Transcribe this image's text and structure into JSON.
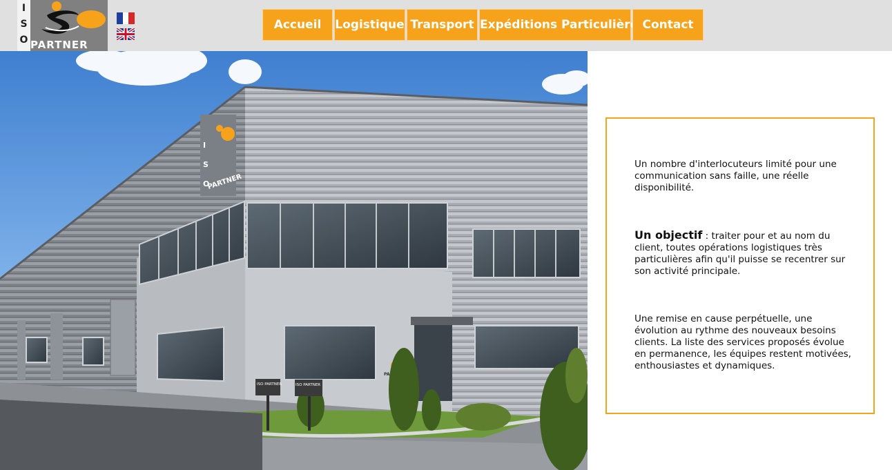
{
  "logo": {
    "letters": [
      "I",
      "S",
      "O"
    ],
    "partner_text": "PARTNER"
  },
  "languages": [
    {
      "code": "fr",
      "icon": "flag-france-icon"
    },
    {
      "code": "en",
      "icon": "flag-uk-icon"
    }
  ],
  "nav": {
    "items": [
      {
        "label": "Accueil"
      },
      {
        "label": "Logistique"
      },
      {
        "label": "Transport"
      },
      {
        "label": "Expéditions Particulières"
      },
      {
        "label": "Contact"
      }
    ]
  },
  "photo": {
    "sign_1": "ISO PARTNER",
    "sign_2": "ISO PARTNER",
    "wall_logo_letters": [
      "I",
      "S",
      "O"
    ],
    "wall_logo_partner": "PARTNER",
    "entrance_logo": "PARTNER"
  },
  "content": {
    "paragraph_1": "Un nombre d'interlocuteurs limité pour une communication sans faille, une réelle disponibilité.",
    "paragraph_2_lead": "Un objectif",
    "paragraph_2_rest": " : traiter pour et au nom du client, toutes opérations logistiques très particulières afin qu'il puisse se recentrer sur son activité principale.",
    "paragraph_3": "Une remise en cause perpétuelle, une évolution au rythme des nouveaux besoins clients. La liste des services proposés évolue en permanence, les équipes restent motivées, enthousiastes et dynamiques."
  },
  "colors": {
    "accent": "#f7a21b",
    "header_bg": "#e0e0e0",
    "logo_bg": "#808080"
  }
}
